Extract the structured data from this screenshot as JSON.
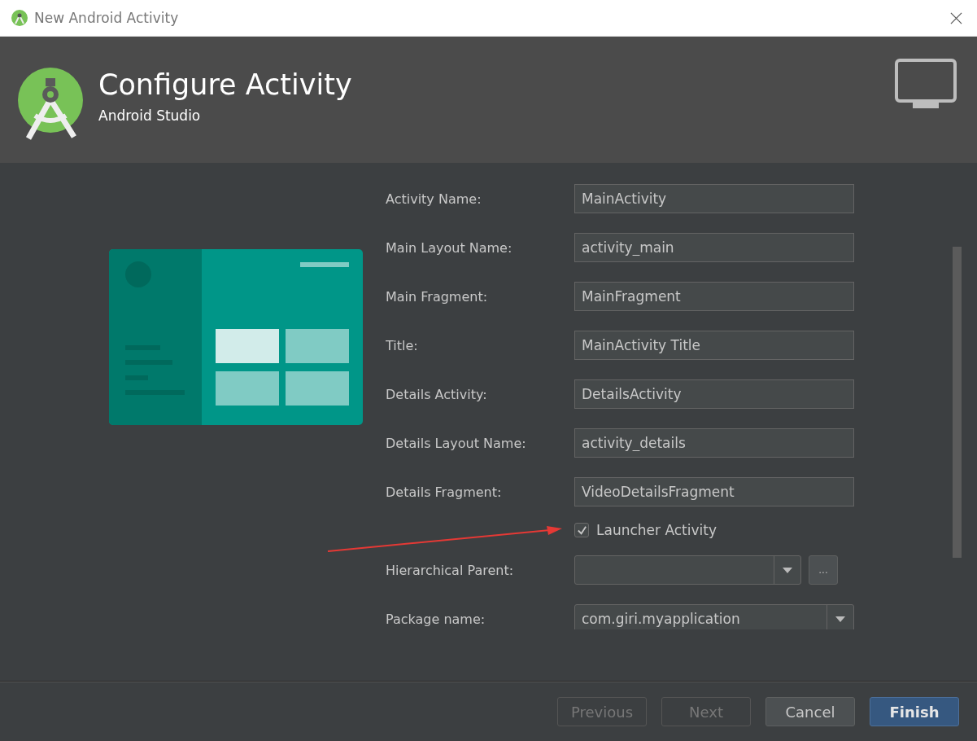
{
  "window": {
    "title": "New Android Activity"
  },
  "header": {
    "title": "Configure Activity",
    "subtitle": "Android Studio"
  },
  "form": [
    {
      "kind": "text",
      "label": "Activity Name:",
      "value": "MainActivity"
    },
    {
      "kind": "text",
      "label": "Main Layout Name:",
      "value": "activity_main"
    },
    {
      "kind": "text",
      "label": "Main Fragment:",
      "value": "MainFragment"
    },
    {
      "kind": "text",
      "label": "Title:",
      "value": "MainActivity Title"
    },
    {
      "kind": "text",
      "label": "Details Activity:",
      "value": "DetailsActivity"
    },
    {
      "kind": "text",
      "label": "Details Layout Name:",
      "value": "activity_details"
    },
    {
      "kind": "text",
      "label": "Details Fragment:",
      "value": "VideoDetailsFragment"
    },
    {
      "kind": "checkbox",
      "label": "Launcher Activity",
      "checked": true
    },
    {
      "kind": "combo",
      "label": "Hierarchical Parent:",
      "browse": "..."
    },
    {
      "kind": "combo",
      "label": "Package name:",
      "value": "com.giri.myapplication"
    }
  ],
  "buttons": [
    {
      "label": "Previous",
      "disabled": true,
      "primary": false
    },
    {
      "label": "Next",
      "disabled": true,
      "primary": false
    },
    {
      "label": "Cancel",
      "disabled": false,
      "primary": false
    },
    {
      "label": "Finish",
      "disabled": false,
      "primary": true
    }
  ]
}
